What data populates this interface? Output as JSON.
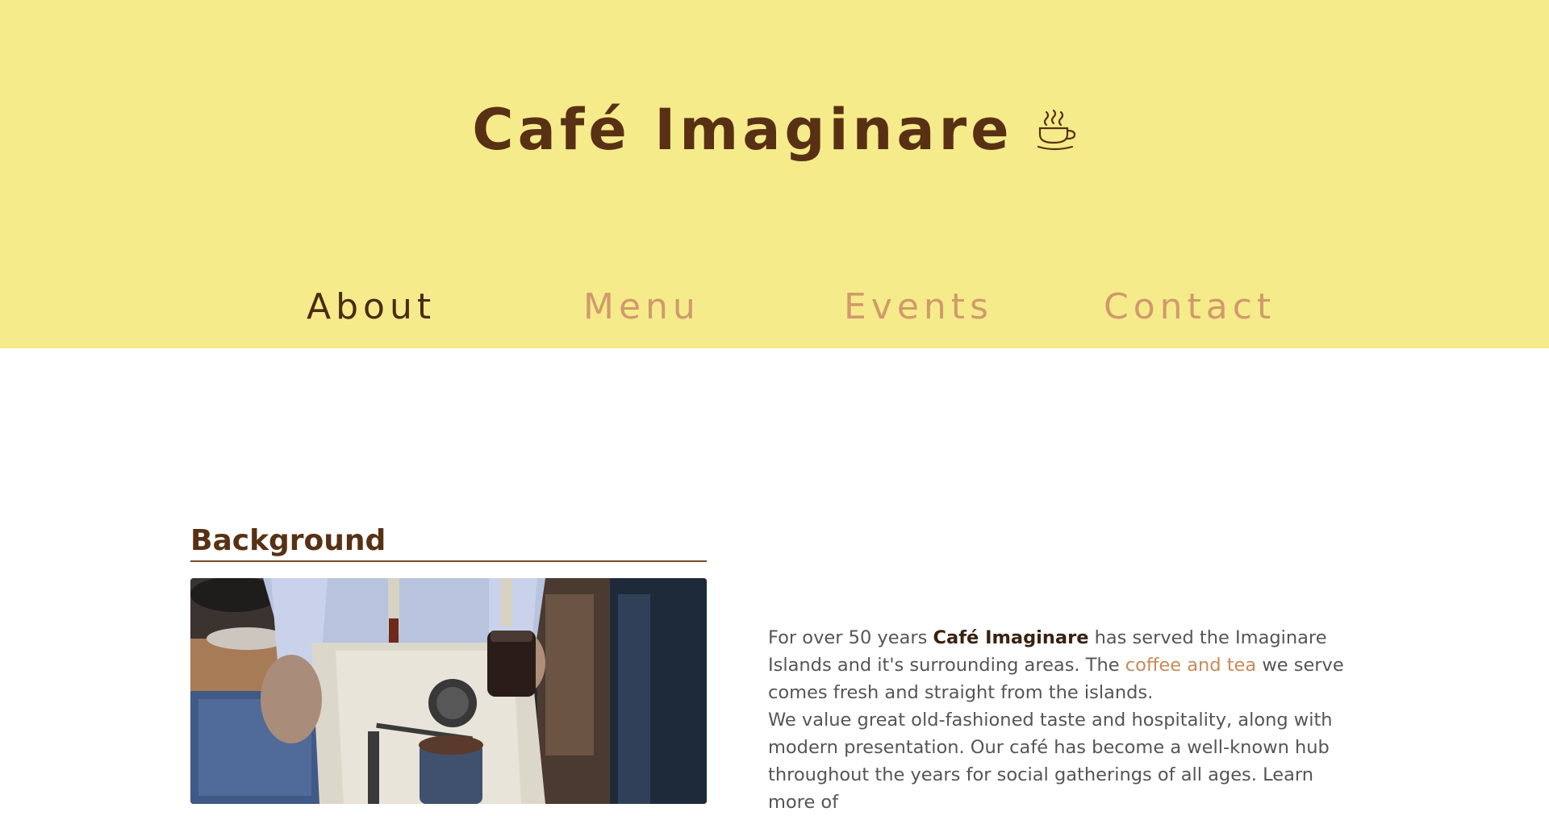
{
  "header": {
    "title": "Café Imaginare",
    "icon": "coffee-cup-icon"
  },
  "nav": {
    "items": [
      {
        "label": "About",
        "active": true
      },
      {
        "label": "Menu",
        "active": false
      },
      {
        "label": "Events",
        "active": false
      },
      {
        "label": "Contact",
        "active": false
      }
    ]
  },
  "background": {
    "heading": "Background",
    "image": "coffee-maker-photo",
    "para1": {
      "before": "For over 50 years ",
      "brand": "Café Imaginare",
      "middle": " has served the Imaginare Islands and it's surrounding areas. The ",
      "link": "coffee and tea",
      "after": " we serve comes fresh and straight from the islands."
    },
    "para2": "We value great old-fashioned taste and hospitality, along with modern presentation. Our café has become a well-known hub throughout the years for social gatherings of all ages. Learn more of"
  },
  "colors": {
    "header_bg": "#f6eb8a",
    "brand": "#583114",
    "nav_inactive": "#d09a6c",
    "link": "#c88a5a"
  }
}
